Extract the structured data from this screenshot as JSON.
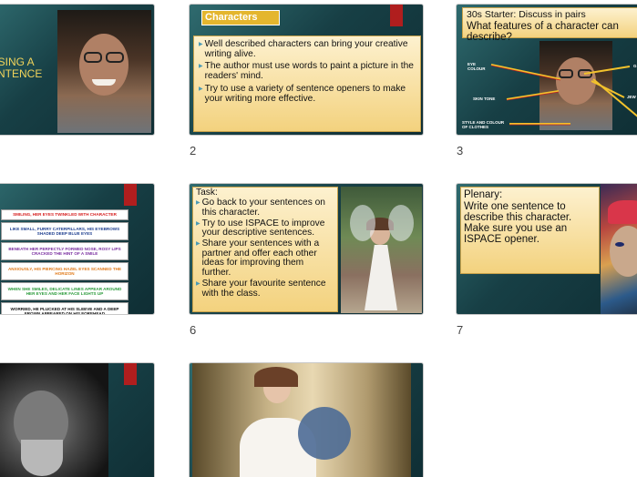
{
  "slides": {
    "s1": {
      "title_line1": "A",
      "title_line2": "USING A",
      "title_line3": "ENTENCE"
    },
    "s2": {
      "number": "2",
      "title": "Characters",
      "bullets": [
        "Well described characters can bring your creative writing alive.",
        "The author must use words to paint a picture in the readers' mind.",
        "Try to use a variety of sentence openers to make your writing more effective."
      ]
    },
    "s3": {
      "number": "3",
      "heading": "30s Starter: Discuss in pairs",
      "question": "What features of a character can describe?",
      "labels": {
        "eye": "EYE COLOUR",
        "skin": "SKIN TONE",
        "style": "STYLE AND COLOUR OF CLOTHES",
        "g": "G",
        "jew": "JEW"
      }
    },
    "s5": {
      "strips": [
        {
          "text": "SMILING, HER EYES TWINKLED WITH CHARACTER",
          "color": "#d62020"
        },
        {
          "text": "LIKE SMALL, FURRY CATERPILLARS, HIS EYEBROWS SHADED DEEP BLUE EYES",
          "color": "#1f3f8f"
        },
        {
          "text": "BENEATH HER PERFECTLY FORMED NOSE, ROSY LIPS CRACKED THE HINT OF A SMILE",
          "color": "#7a2fa0"
        },
        {
          "text": "ANXIOUSLY, HIS PIERCING HAZEL EYES SCANNED THE HORIZON",
          "color": "#e07a1a"
        },
        {
          "text": "WHEN SHE SMILES, DELICATE LINES APPEAR AROUND HER EYES AND HER FACE LIGHTS UP",
          "color": "#2a9a3a"
        },
        {
          "text": "WORRIED, HE PLUCKED AT HIS SLEEVE AND A DEEP FROWN APPEARED ON HIS FOREHEAD",
          "color": "#111111"
        }
      ]
    },
    "s6": {
      "number": "6",
      "title": "Task:",
      "bullets": [
        "Go back to your sentences on this character.",
        "Try to use ISPACE to improve your descriptive sentences.",
        "Share your sentences with a partner and offer each other ideas for improving them further.",
        "Share your favourite sentence with the class."
      ]
    },
    "s7": {
      "number": "7",
      "title": "Plenary:",
      "body": "Write one sentence to describe this character. Make sure you use an ISPACE opener."
    }
  }
}
